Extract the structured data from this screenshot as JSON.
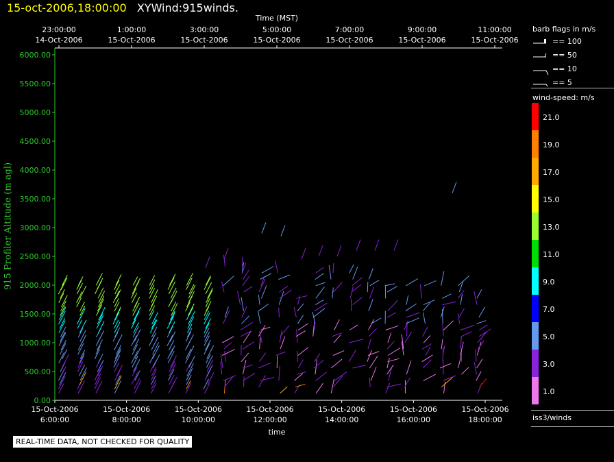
{
  "header": {
    "date_text": "15-oct-2006,18:00:00",
    "product_text": "XYWind:915winds."
  },
  "notice": "REAL-TIME DATA, NOT CHECKED FOR QUALITY",
  "chart_data": {
    "type": "wind-barb",
    "top_axis": {
      "title": "Time (MST)",
      "ticks": [
        {
          "time": "23:00:00",
          "date": "14-Oct-2006"
        },
        {
          "time": "1:00:00",
          "date": "15-Oct-2006"
        },
        {
          "time": "3:00:00",
          "date": "15-Oct-2006"
        },
        {
          "time": "5:00:00",
          "date": "15-Oct-2006"
        },
        {
          "time": "7:00:00",
          "date": "15-Oct-2006"
        },
        {
          "time": "9:00:00",
          "date": "15-Oct-2006"
        },
        {
          "time": "11:00:00",
          "date": "15-Oct-2006"
        }
      ]
    },
    "bottom_axis": {
      "title": "time",
      "ticks": [
        {
          "date": "15-Oct-2006",
          "time": "6:00:00"
        },
        {
          "date": "15-Oct-2006",
          "time": "8:00:00"
        },
        {
          "date": "15-Oct-2006",
          "time": "10:00:00"
        },
        {
          "date": "15-Oct-2006",
          "time": "12:00:00"
        },
        {
          "date": "15-Oct-2006",
          "time": "14:00:00"
        },
        {
          "date": "15-Oct-2006",
          "time": "16:00:00"
        },
        {
          "date": "15-Oct-2006",
          "time": "18:00:00"
        }
      ]
    },
    "y_axis": {
      "title": "915 Profiler Altitude (m agl)",
      "ticks": [
        "0.00",
        "500.00",
        "1000.00",
        "1500.00",
        "2000.00",
        "2500.00",
        "3000.00",
        "3500.00",
        "4000.00",
        "4500.00",
        "5000.00",
        "5500.00",
        "6000.00"
      ],
      "range": [
        0,
        6000
      ]
    },
    "x_range_hours": [
      6,
      18
    ],
    "barb_legend": {
      "title": "barb flags in m/s",
      "entries": [
        "== 100",
        "== 50",
        "== 10",
        "== 5"
      ]
    },
    "speed_legend": {
      "title": "wind-speed: m/s",
      "levels": [
        {
          "label": "21.0",
          "color": "#ff0000"
        },
        {
          "label": "19.0",
          "color": "#ff7f00"
        },
        {
          "label": "17.0",
          "color": "#ffaa00"
        },
        {
          "label": "15.0",
          "color": "#ffff00"
        },
        {
          "label": "13.0",
          "color": "#99ff33"
        },
        {
          "label": "11.0",
          "color": "#00dd00"
        },
        {
          "label": "9.0",
          "color": "#00ffff"
        },
        {
          "label": "7.0",
          "color": "#0000ff"
        },
        {
          "label": "5.0",
          "color": "#6699ee"
        },
        {
          "label": "3.0",
          "color": "#8822dd"
        },
        {
          "label": "1.0",
          "color": "#ee77ee"
        }
      ]
    },
    "station_label": "iss3/winds"
  }
}
